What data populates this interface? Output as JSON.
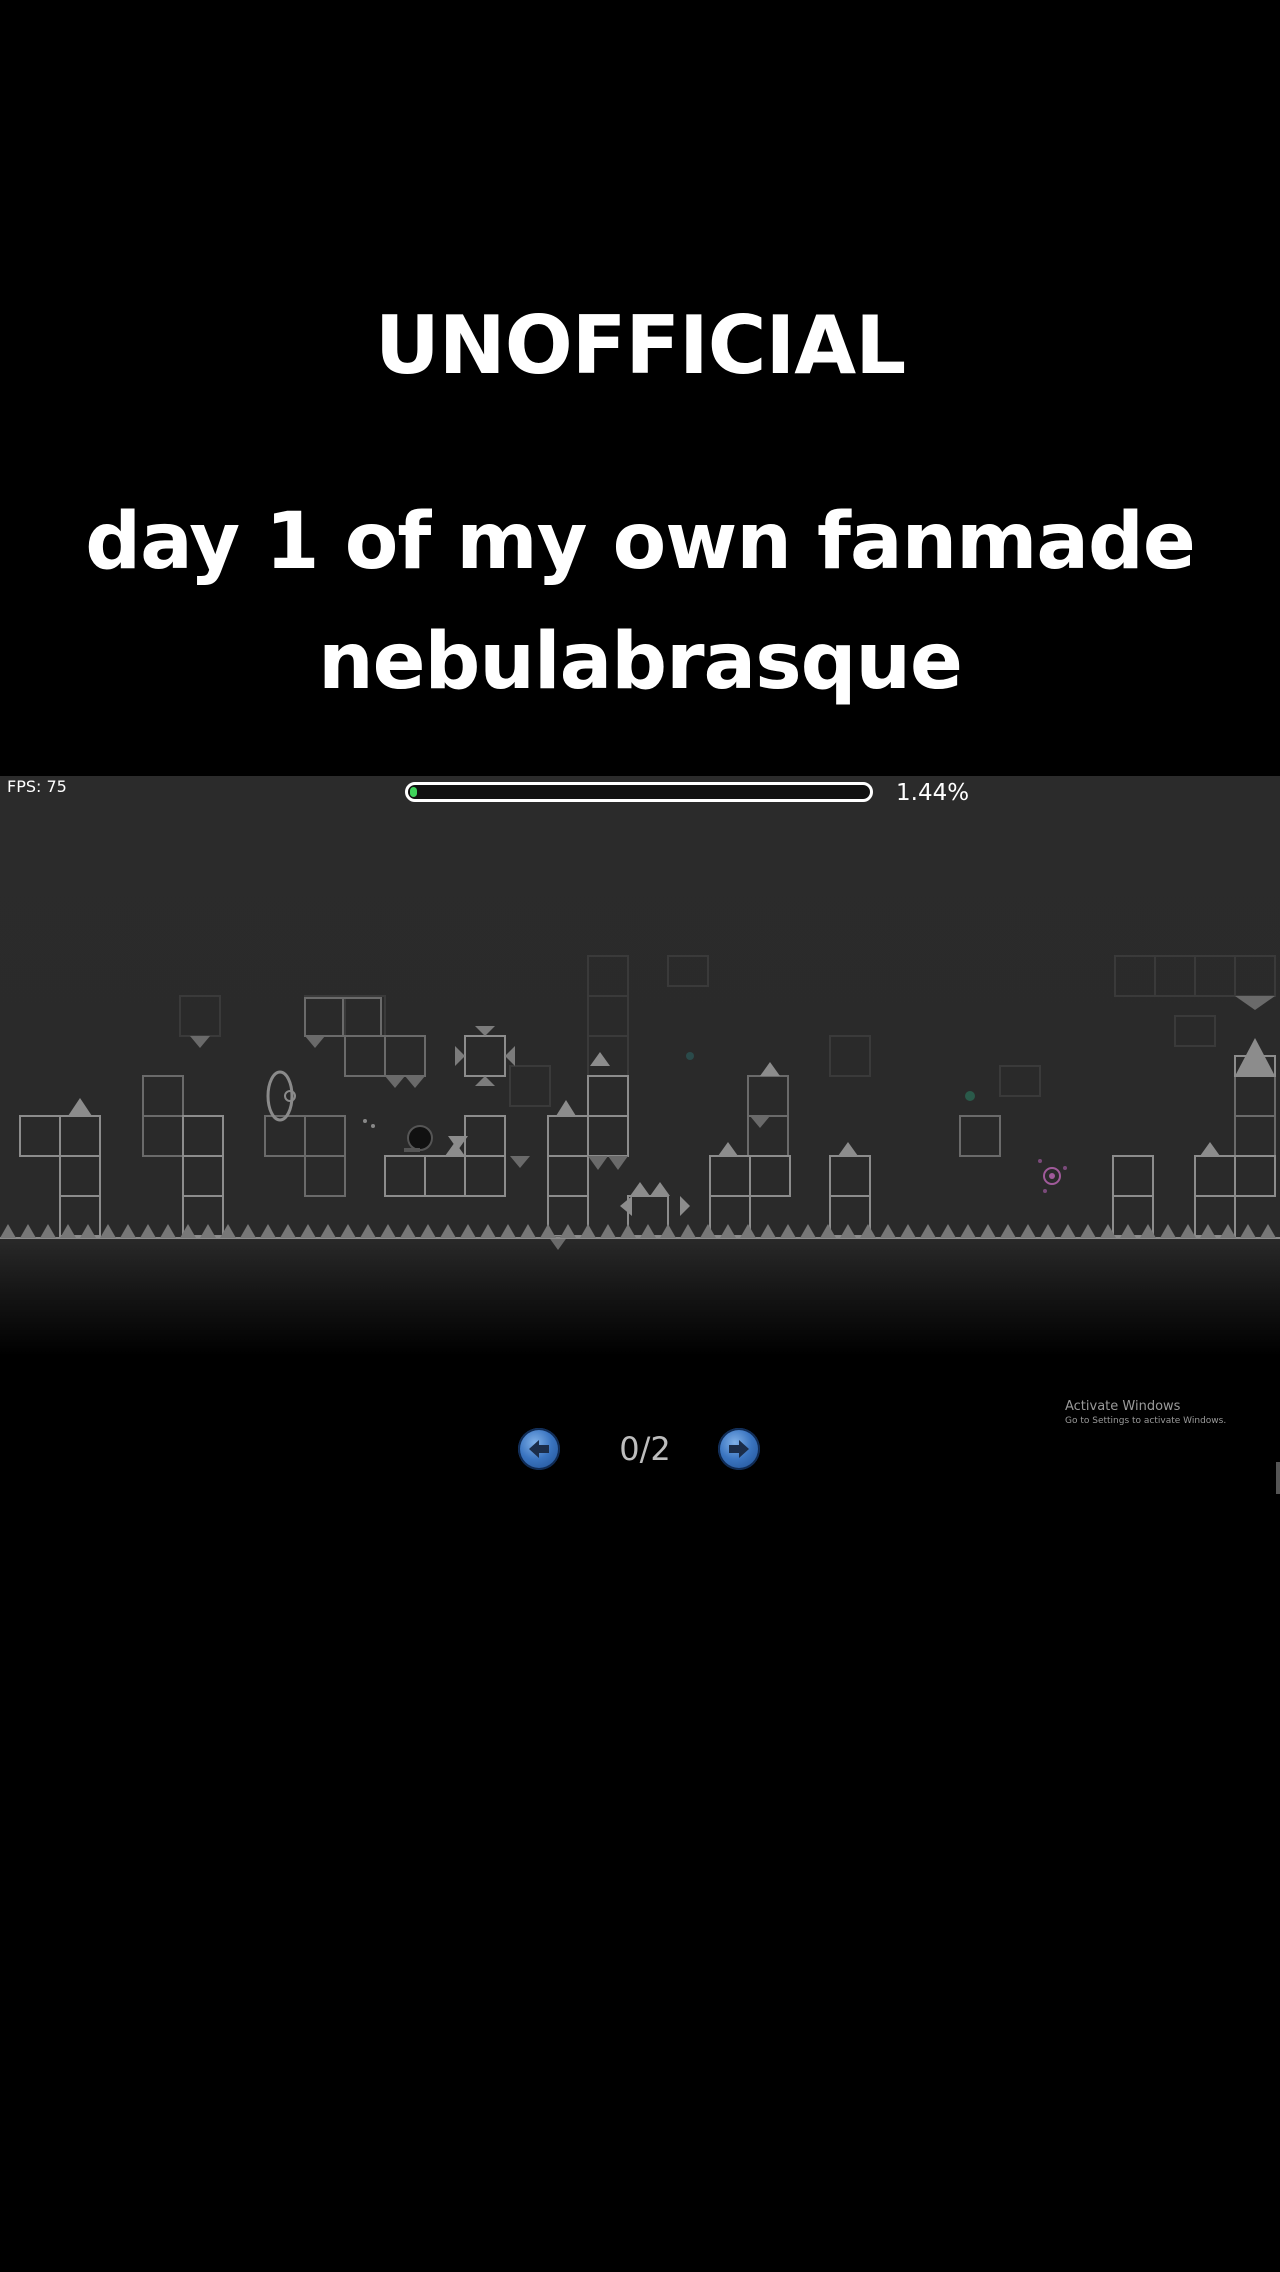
{
  "caption": {
    "top": "UNOFFICIAL",
    "line1": "day 1 of my own fanmade",
    "line2": "nebulabrasque"
  },
  "game": {
    "fps_label": "FPS: 75",
    "progress_text": "1.44%",
    "progress_value": 0.0144,
    "progress_color": "#3fd35a",
    "background_color": "#2b2b2b"
  },
  "pager": {
    "prev_icon": "arrow-left-icon",
    "next_icon": "arrow-right-icon",
    "counter": "0/2"
  },
  "watermark": {
    "title": "Activate Windows",
    "subtitle": "Go to Settings to activate Windows."
  }
}
